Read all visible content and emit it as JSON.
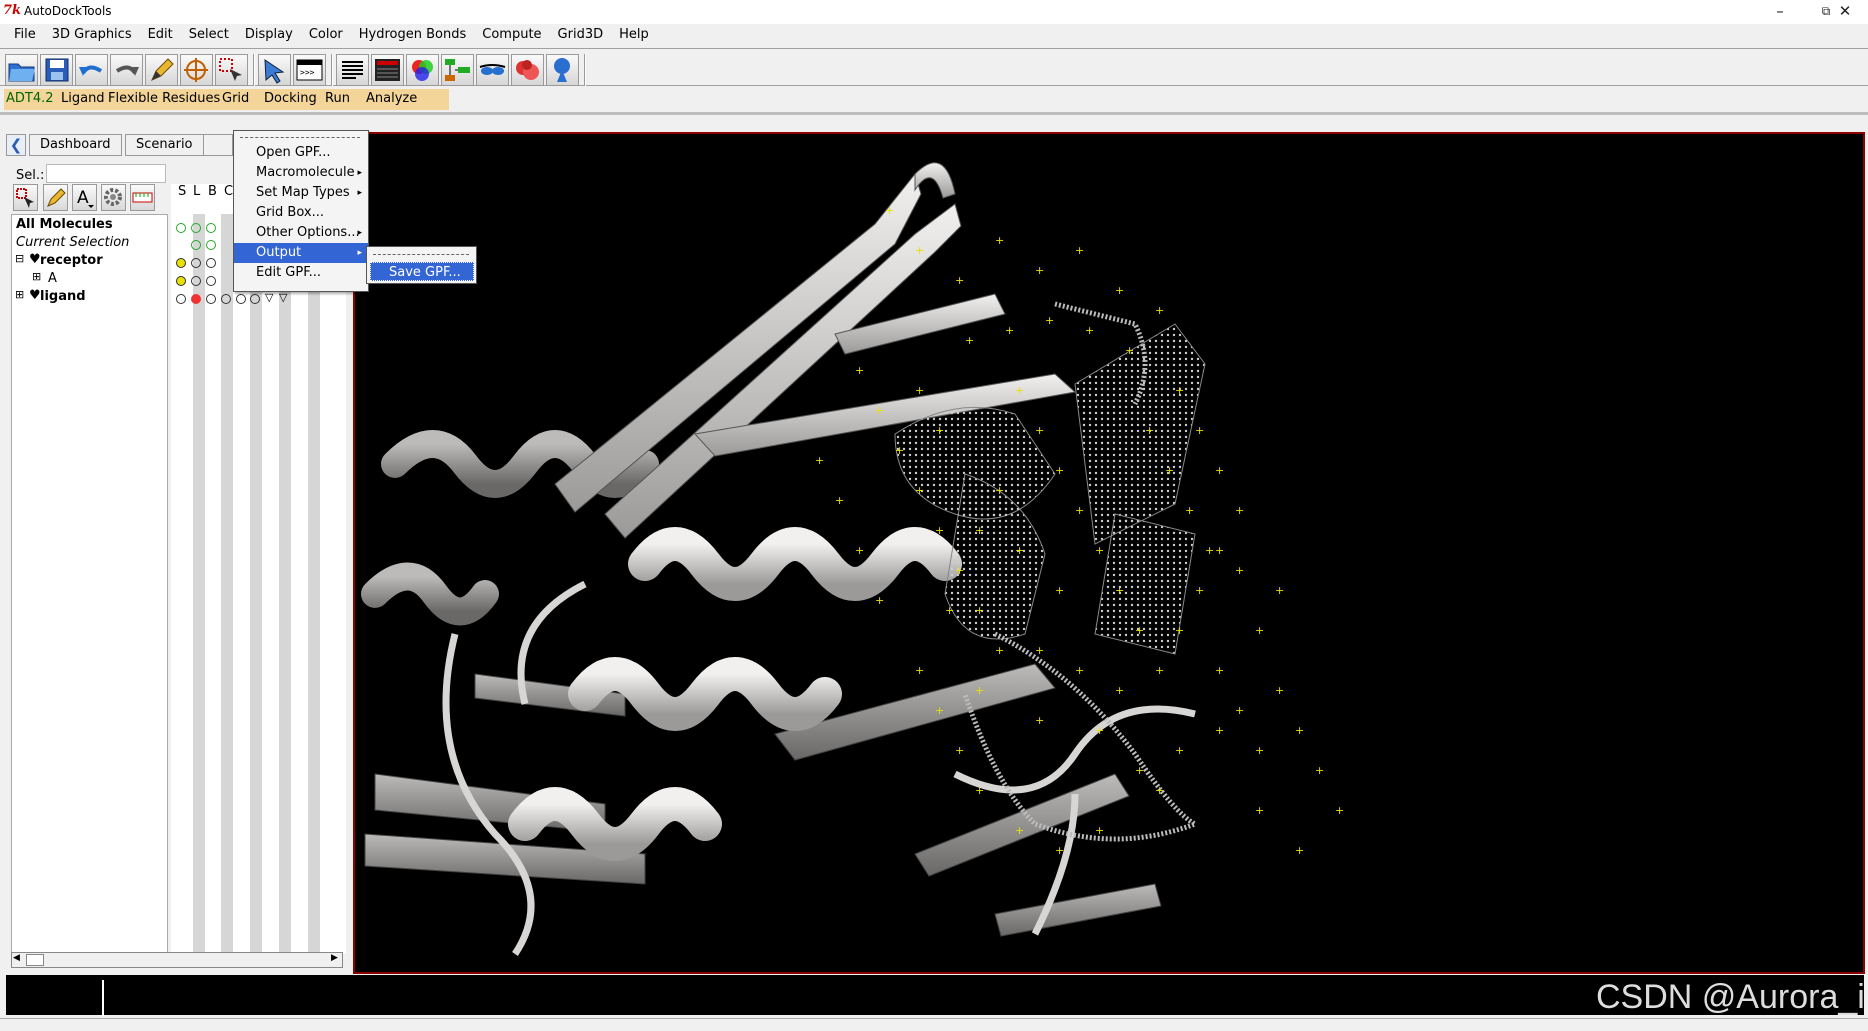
{
  "window": {
    "title": "AutoDockTools",
    "icon_text": "7k"
  },
  "menubar": [
    "File",
    "3D Graphics",
    "Edit",
    "Select",
    "Display",
    "Color",
    "Hydrogen Bonds",
    "Compute",
    "Grid3D",
    "Help"
  ],
  "modules": [
    "ADT4.2",
    "Ligand",
    "Flexible Residues",
    "Grid",
    "Docking",
    "Run",
    "Analyze"
  ],
  "dashboard": {
    "tabs": [
      "Dashboard",
      "Scenario"
    ],
    "sel_label": "Sel.:",
    "sel_value": "",
    "col_headers": [
      "S",
      "L",
      "B",
      "C"
    ],
    "tree": [
      {
        "label": "All Molecules"
      },
      {
        "label": "Current Selection"
      },
      {
        "label": "receptor",
        "expander": "⊟"
      },
      {
        "label": "A",
        "expander": "⊞"
      },
      {
        "label": "ligand",
        "expander": "⊞"
      }
    ]
  },
  "context_menu": {
    "items": [
      "Open GPF...",
      "Macromolecule",
      "Set Map Types",
      "Grid Box...",
      "Other Options...",
      "Output",
      "Edit GPF..."
    ],
    "highlighted": "Output"
  },
  "submenu": {
    "items": [
      "Save GPF..."
    ]
  },
  "watermark": "CSDN @Aurora_i",
  "colors": {
    "module_bar": "#f3d59a",
    "highlight": "#3465d5",
    "viewer_border": "#8b0000",
    "grid_points": "#e8e000",
    "ribbon": "#d8d6d4"
  },
  "toolbar_icons": [
    "open-folder-icon",
    "save-icon",
    "undo-icon",
    "redo-icon",
    "pencil-icon",
    "target-icon",
    "select-icon",
    "pointer-icon",
    "python-shell-icon",
    "text-icon",
    "dashboard-icon",
    "color-icon",
    "graph-icon",
    "glasses-icon",
    "pmv-icon",
    "adt-icon"
  ]
}
